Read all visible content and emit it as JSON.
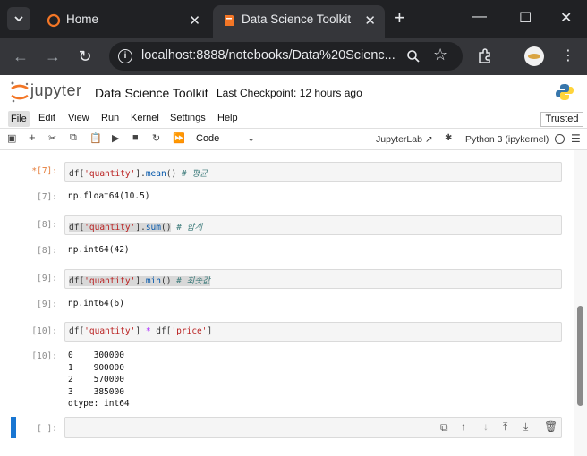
{
  "browser": {
    "tabs": [
      {
        "label": "Home",
        "icon": "jupyter-favicon",
        "active": false
      },
      {
        "label": "Data Science Toolkit",
        "icon": "notebook-favicon",
        "active": true
      }
    ],
    "url": "localhost:8888/notebooks/Data%20Scienc..."
  },
  "jupyter": {
    "logo_text": "jupyter",
    "notebook_title": "Data Science Toolkit",
    "checkpoint": "Last Checkpoint: 12 hours ago",
    "menu": [
      "File",
      "Edit",
      "View",
      "Run",
      "Kernel",
      "Settings",
      "Help"
    ],
    "trusted": "Trusted",
    "cell_type": "Code",
    "jupyterlab_link": "JupyterLab",
    "kernel": "Python 3 (ipykernel)"
  },
  "cells": [
    {
      "in_prompt": "*[7]:",
      "out_prompt": "[7]:",
      "code": "df['quantity'].mean() # 평균",
      "output": "np.float64(10.5)"
    },
    {
      "in_prompt": "[8]:",
      "out_prompt": "[8]:",
      "code": "df['quantity'].sum() # 합계",
      "output": "np.int64(42)"
    },
    {
      "in_prompt": "[9]:",
      "out_prompt": "[9]:",
      "code": "df['quantity'].min() # 최솟값",
      "output": "np.int64(6)"
    },
    {
      "in_prompt": "[10]:",
      "out_prompt": "[10]:",
      "code": "df['quantity'] * df['price']",
      "output": "0    300000\n1    900000\n2    570000\n3    385000\ndtype: int64"
    },
    {
      "in_prompt": "[ ]:",
      "code": ""
    }
  ],
  "colors": {
    "active_cell": "#1976d2",
    "dirty_prompt": "#e57d3b"
  }
}
